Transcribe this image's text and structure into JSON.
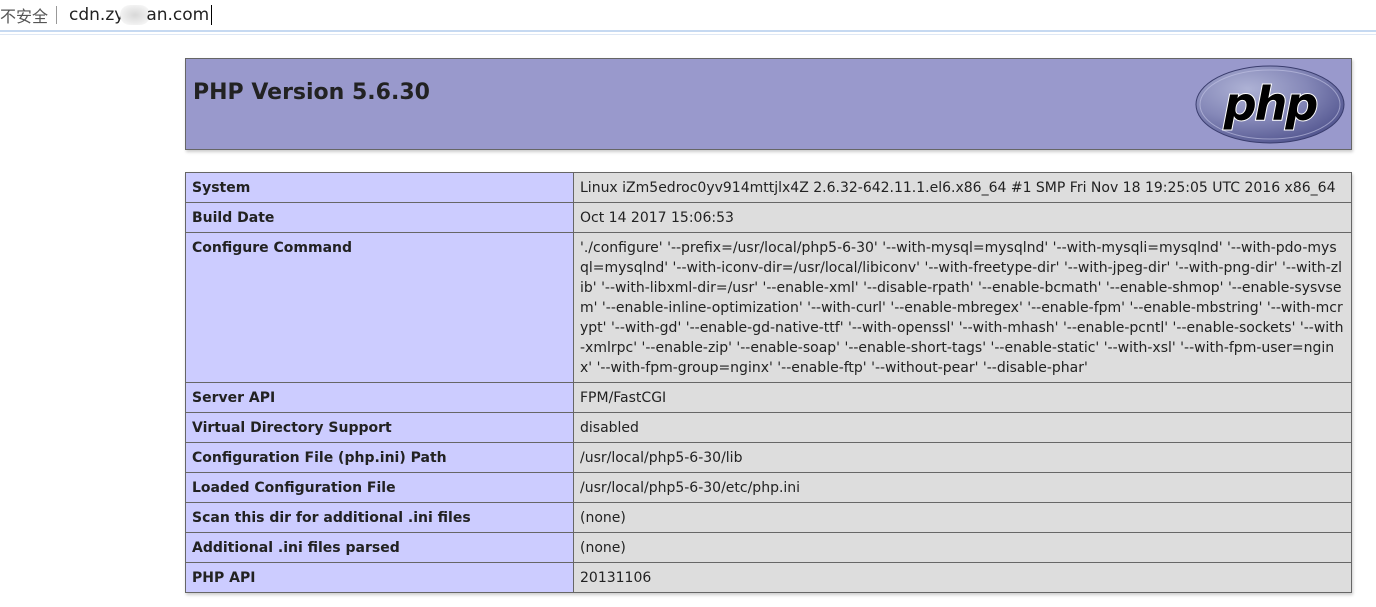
{
  "browser": {
    "security_label": "不安全",
    "url_prefix": "cdn.zy",
    "url_suffix": "an.com"
  },
  "header": {
    "title": "PHP Version 5.6.30",
    "logo_text": "php"
  },
  "rows": [
    {
      "key": "System",
      "value": "Linux iZm5edroc0yv914mttjlx4Z 2.6.32-642.11.1.el6.x86_64 #1 SMP Fri Nov 18 19:25:05 UTC 2016 x86_64"
    },
    {
      "key": "Build Date",
      "value": "Oct 14 2017 15:06:53"
    },
    {
      "key": "Configure Command",
      "value": "'./configure' '--prefix=/usr/local/php5-6-30' '--with-mysql=mysqlnd' '--with-mysqli=mysqlnd' '--with-pdo-mysql=mysqlnd' '--with-iconv-dir=/usr/local/libiconv' '--with-freetype-dir' '--with-jpeg-dir' '--with-png-dir' '--with-zlib' '--with-libxml-dir=/usr' '--enable-xml' '--disable-rpath' '--enable-bcmath' '--enable-shmop' '--enable-sysvsem' '--enable-inline-optimization' '--with-curl' '--enable-mbregex' '--enable-fpm' '--enable-mbstring' '--with-mcrypt' '--with-gd' '--enable-gd-native-ttf' '--with-openssl' '--with-mhash' '--enable-pcntl' '--enable-sockets' '--with-xmlrpc' '--enable-zip' '--enable-soap' '--enable-short-tags' '--enable-static' '--with-xsl' '--with-fpm-user=nginx' '--with-fpm-group=nginx' '--enable-ftp' '--without-pear' '--disable-phar'"
    },
    {
      "key": "Server API",
      "value": "FPM/FastCGI"
    },
    {
      "key": "Virtual Directory Support",
      "value": "disabled"
    },
    {
      "key": "Configuration File (php.ini) Path",
      "value": "/usr/local/php5-6-30/lib"
    },
    {
      "key": "Loaded Configuration File",
      "value": "/usr/local/php5-6-30/etc/php.ini"
    },
    {
      "key": "Scan this dir for additional .ini files",
      "value": "(none)"
    },
    {
      "key": "Additional .ini files parsed",
      "value": "(none)"
    },
    {
      "key": "PHP API",
      "value": "20131106"
    }
  ],
  "colors": {
    "header_bg": "#9999cc",
    "key_bg": "#ccccff",
    "value_bg": "#dddddd"
  }
}
